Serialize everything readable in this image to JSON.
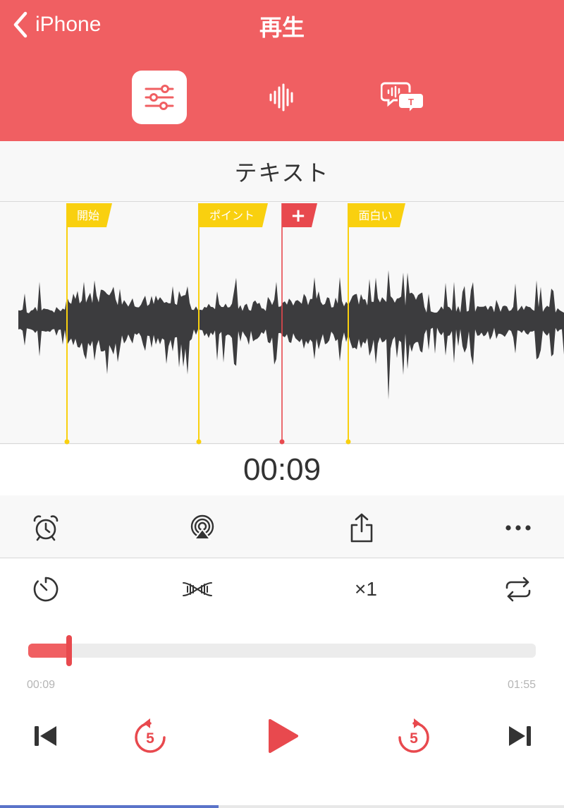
{
  "nav": {
    "back_label": "iPhone",
    "title": "再生"
  },
  "modes": [
    {
      "icon": "sliders-icon",
      "active": true
    },
    {
      "icon": "waveform-icon",
      "active": false
    },
    {
      "icon": "speech-to-text-icon",
      "active": false
    }
  ],
  "section_title": "テキスト",
  "markers": [
    {
      "label": "開始",
      "time": "00:01",
      "type": "flag",
      "color": "#f9d00f"
    },
    {
      "label": "ポイント",
      "time": "00:06",
      "type": "flag",
      "color": "#f9d00f"
    },
    {
      "label": "+",
      "time": "00:09",
      "type": "playhead",
      "color": "#e8494e"
    },
    {
      "label": "面白い",
      "time": "00:11",
      "type": "flag",
      "color": "#f9d00f"
    }
  ],
  "time_display": "00:09",
  "toolbar_top": [
    {
      "icon": "alarm-clock-icon"
    },
    {
      "icon": "airplay-icon"
    },
    {
      "icon": "share-icon"
    },
    {
      "icon": "more-icon"
    }
  ],
  "toolbar_bottom": [
    {
      "icon": "timer-icon"
    },
    {
      "icon": "noise-reduction-icon"
    },
    {
      "icon": "speed",
      "label": "×1"
    },
    {
      "icon": "repeat-icon"
    }
  ],
  "progress": {
    "elapsed": "00:09",
    "total": "01:55",
    "fraction": 0.08
  },
  "transport": {
    "skip_back_seconds": "5",
    "skip_forward_seconds": "5"
  },
  "colors": {
    "accent": "#f05f62",
    "flag": "#f9d00f",
    "wave": "#3c3c3e",
    "playhead": "#e8494e"
  }
}
